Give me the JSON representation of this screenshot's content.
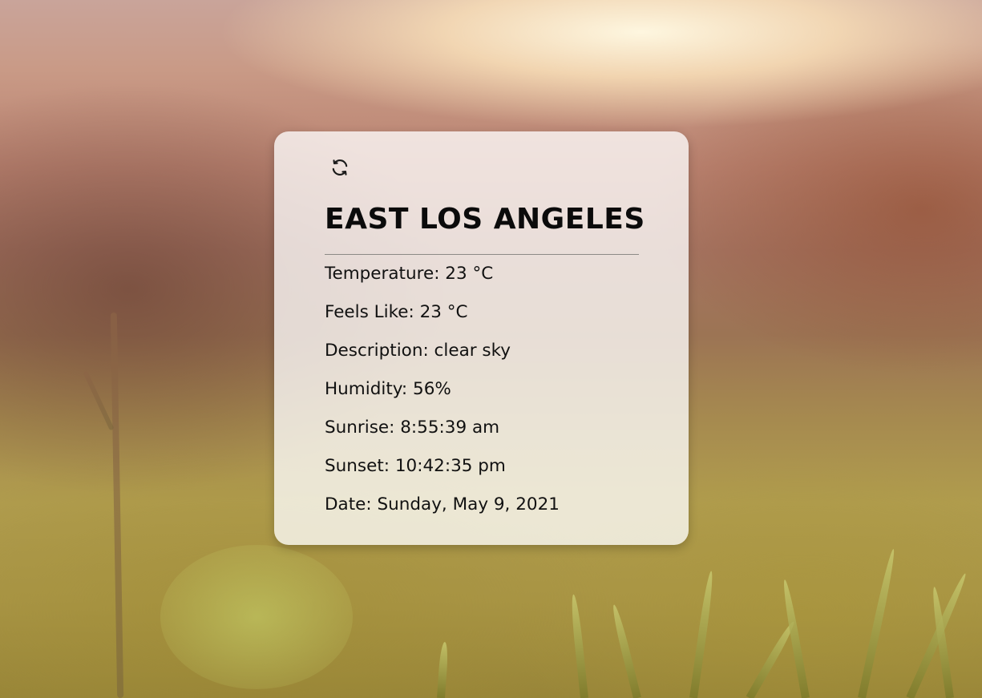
{
  "weather": {
    "city": "EAST LOS ANGELES",
    "rows": [
      {
        "label": "Temperature:",
        "value": "23 °C"
      },
      {
        "label": "Feels Like:",
        "value": "23 °C"
      },
      {
        "label": "Description:",
        "value": "clear sky"
      },
      {
        "label": "Humidity:",
        "value": "56%"
      },
      {
        "label": "Sunrise:",
        "value": "8:55:39 am"
      },
      {
        "label": "Sunset:",
        "value": "10:42:35 pm"
      },
      {
        "label": "Date:",
        "value": "Sunday, May 9, 2021"
      }
    ]
  },
  "icons": {
    "refresh": "refresh-icon"
  },
  "background": {
    "kind": "blurred sunset grass field photo"
  }
}
